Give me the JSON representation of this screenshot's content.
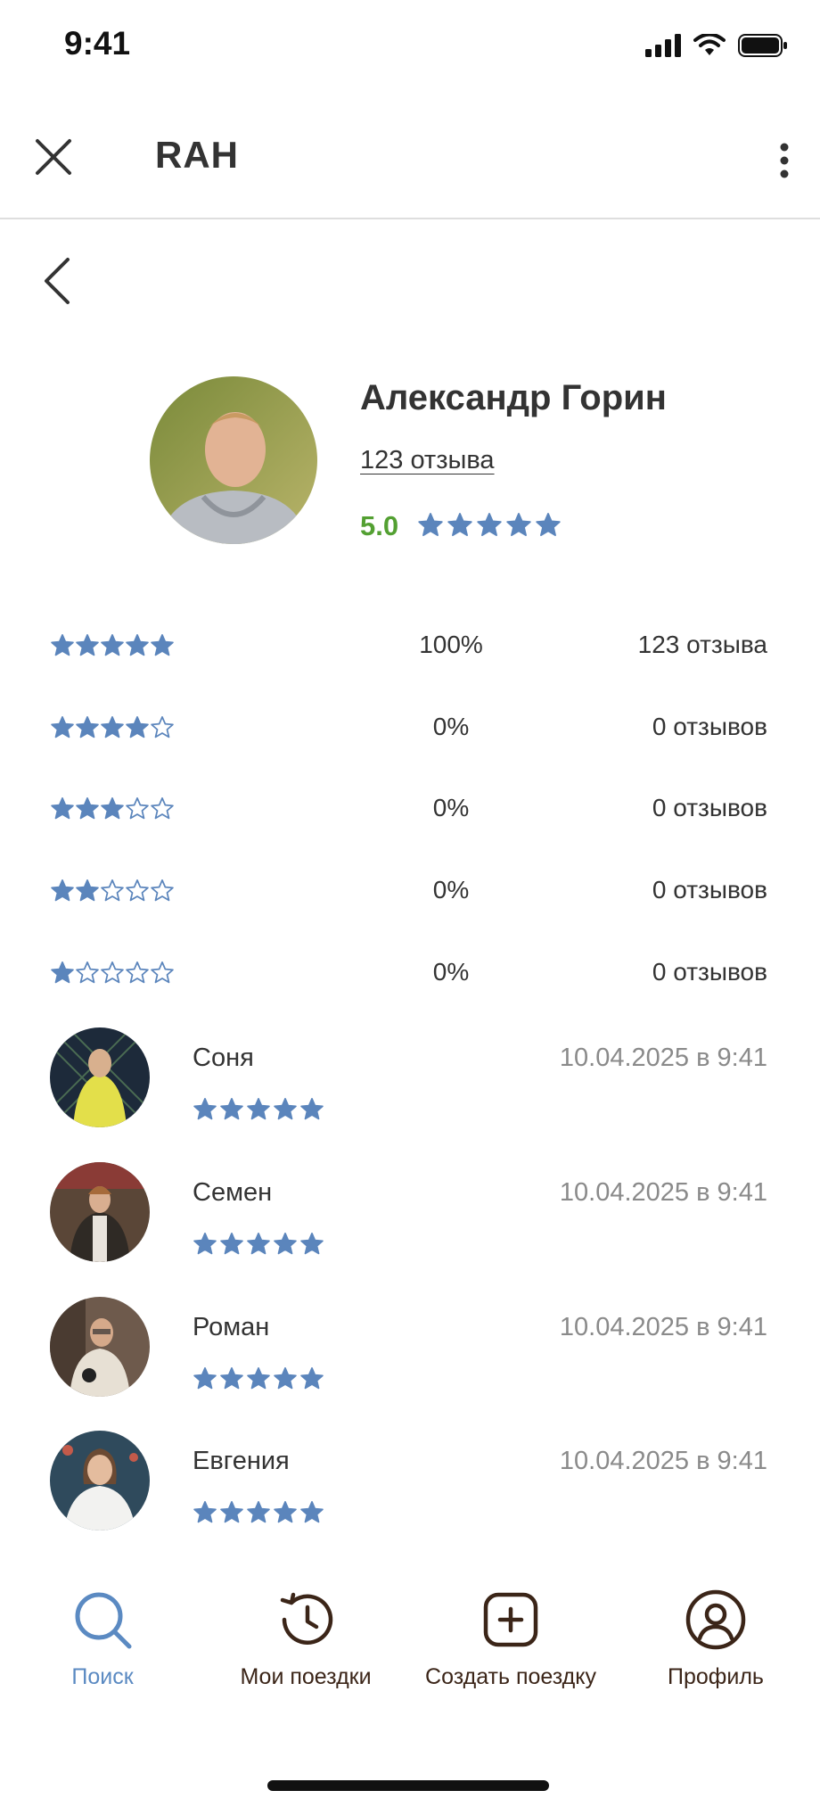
{
  "status_bar": {
    "time": "9:41"
  },
  "header": {
    "title": "RAH"
  },
  "profile": {
    "name": "Александр Горин",
    "reviews_link": "123 отзыва",
    "score": "5.0",
    "stars": 5
  },
  "rating_breakdown": [
    {
      "stars": 5,
      "percent": "100%",
      "count": "123 отзыва"
    },
    {
      "stars": 4,
      "percent": "0%",
      "count": "0 отзывов"
    },
    {
      "stars": 3,
      "percent": "0%",
      "count": "0 отзывов"
    },
    {
      "stars": 2,
      "percent": "0%",
      "count": "0 отзывов"
    },
    {
      "stars": 1,
      "percent": "0%",
      "count": "0 отзывов"
    }
  ],
  "reviews": [
    {
      "name": "Соня",
      "date": "10.04.2025 в 9:41",
      "stars": 5
    },
    {
      "name": "Семен",
      "date": "10.04.2025 в 9:41",
      "stars": 5
    },
    {
      "name": "Роман",
      "date": "10.04.2025 в 9:41",
      "stars": 5
    },
    {
      "name": "Евгения",
      "date": "10.04.2025 в 9:41",
      "stars": 5
    }
  ],
  "bottom_nav": [
    {
      "label": "Поиск",
      "icon": "search-icon",
      "active": true
    },
    {
      "label": "Мои поездки",
      "icon": "history-icon",
      "active": false
    },
    {
      "label": "Создать поездку",
      "icon": "add-square-icon",
      "active": false
    },
    {
      "label": "Профиль",
      "icon": "profile-icon",
      "active": false
    }
  ],
  "colors": {
    "star": "#5b85bc",
    "score": "#53a032",
    "nav_active": "#5b8ac2",
    "nav_inactive": "#3b2518"
  }
}
